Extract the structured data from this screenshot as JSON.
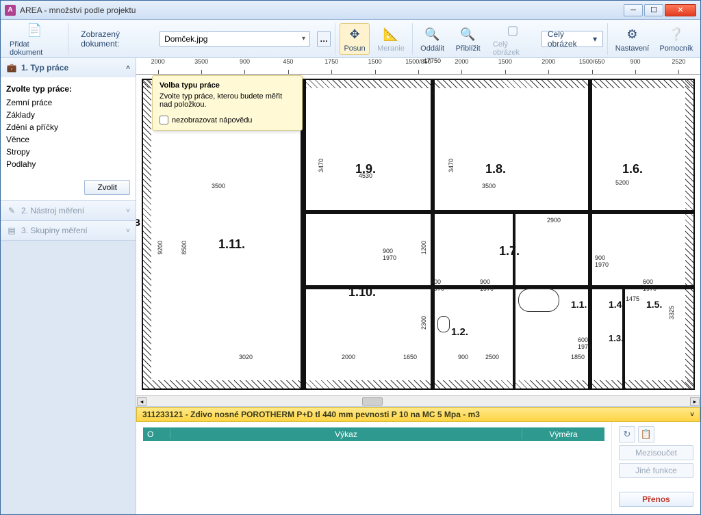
{
  "window": {
    "title": "AREA - množství podle projektu"
  },
  "toolbar": {
    "add_doc": "Přidat dokument",
    "doc_label": "Zobrazený dokument:",
    "doc_value": "Domček.jpg",
    "posun": "Posun",
    "meranie": "Meranie",
    "oddalit": "Oddálit",
    "priblizit": "Přiblížit",
    "cely_obrazek": "Celý obrázek",
    "cely_obrazek_dd": "Celý obrázek",
    "nastaveni": "Nastavení",
    "pomocnik": "Pomocník"
  },
  "sidebar": {
    "sec1": "1. Typ práce",
    "choose_label": "Zvolte typ práce:",
    "items": [
      "Zemní práce",
      "Základy",
      "Zdění a příčky",
      "Věnce",
      "Stropy",
      "Podlahy"
    ],
    "zvolit": "Zvolit",
    "sec2": "2. Nástroj měření",
    "sec3": "3. Skupiny měření"
  },
  "tooltip": {
    "title": "Volba typu práce",
    "body": "Zvolte typ práce, kterou budete měřit nad položkou.",
    "check": "nezobrazovat nápovědu"
  },
  "ruler": [
    "2000",
    "3500",
    "900",
    "450",
    "1750",
    "1500",
    "1500/850",
    "2000",
    "1500",
    "2000",
    "1500/650",
    "900",
    "2520"
  ],
  "rooms": {
    "r111": "1.11.",
    "r110": "1.10.",
    "r19": "1.9.",
    "r18": "1.8.",
    "r17": "1.7.",
    "r16": "1.6.",
    "r15": "1.5.",
    "r14": "1.4.",
    "r13": "1.3.",
    "r12": "1.2.",
    "r11": "1.1."
  },
  "dims": {
    "d3500": "3500",
    "d8500": "8500",
    "d9200": "9200",
    "d3470a": "3470",
    "d3470b": "3470",
    "d5200": "5200",
    "d3000": "3020",
    "d17750": "17750",
    "d2000": "2000",
    "d1650": "1650",
    "d900": "900",
    "d1970": "1970",
    "d2500": "2500",
    "d1475": "1475",
    "d600": "600",
    "d3325": "3325",
    "d1200": "1200",
    "d2300": "2300",
    "d2900": "2900",
    "d1850": "1850",
    "d4530": "4530"
  },
  "floorplan_letter": "B",
  "item_bar": "311233121 - Zdivo nosné POROTHERM P+D tl 440 mm pevnosti P 10 na MC 5 Mpa - m3",
  "calc_table": {
    "c1": "O",
    "c2": "Výkaz",
    "c3": "Výměra"
  },
  "right": {
    "mezisoucet": "Mezisoučet",
    "jine": "Jiné funkce",
    "prenos": "Přenos"
  }
}
